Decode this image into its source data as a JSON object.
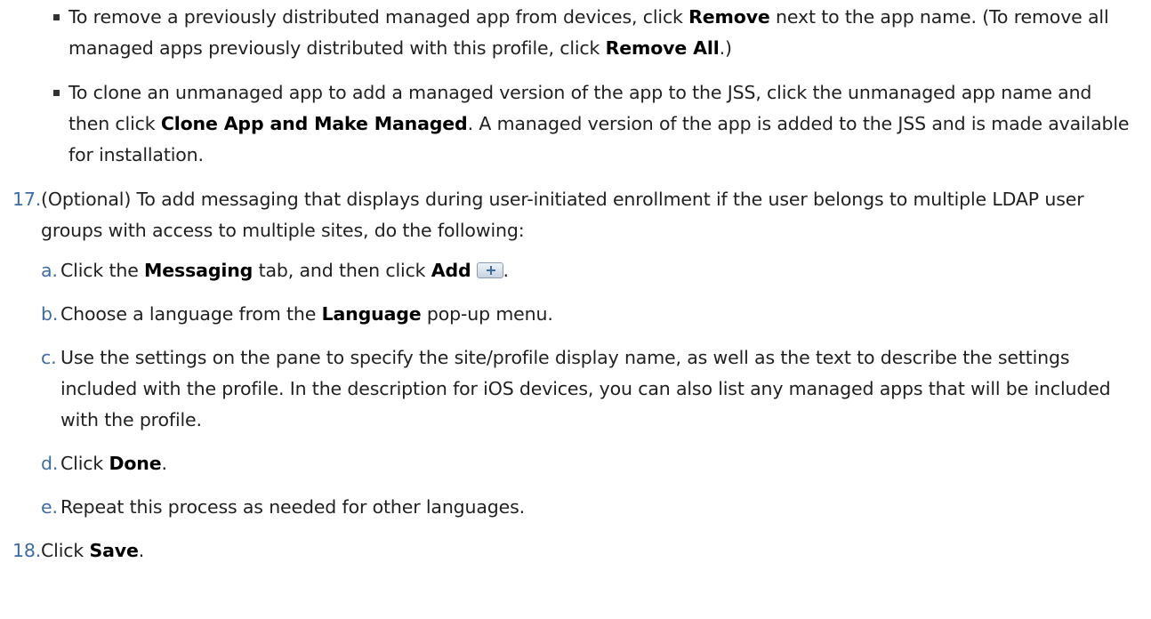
{
  "bullets": [
    {
      "t1": "To remove a previously distributed managed app from devices, click ",
      "b1": "Remove",
      "t2": " next to the app name. (To remove all managed apps previously distributed with this profile, click ",
      "b2": "Remove All",
      "t3": ".)"
    },
    {
      "t1": "To clone an unmanaged app to add a managed version of the app to the JSS, click the unmanaged app name and then click ",
      "b1": "Clone App and Make Managed",
      "t2": ". A managed version of the app is added to the JSS and is made available for installation."
    }
  ],
  "step17": {
    "num": "17.",
    "text": "(Optional) To add messaging that displays during user-initiated enrollment if the user belongs to multiple LDAP user groups with access to multiple sites, do the following:",
    "substeps": {
      "a": {
        "letter": "a.",
        "t1": "Click the ",
        "b1": "Messaging",
        "t2": " tab, and then click ",
        "b2": "Add",
        "t3": "."
      },
      "b": {
        "letter": "b.",
        "t1": "Choose a language from the ",
        "b1": "Language",
        "t2": " pop-up menu."
      },
      "c": {
        "letter": "c.",
        "t1": "Use the settings on the pane to specify the site/profile display name, as well as the text to describe the settings included with the profile. In the description for iOS devices, you can also list any managed apps that will be included with the profile."
      },
      "d": {
        "letter": "d.",
        "t1": "Click ",
        "b1": "Done",
        "t2": "."
      },
      "e": {
        "letter": "e.",
        "t1": "Repeat this process as needed for other languages."
      }
    }
  },
  "step18": {
    "num": "18.",
    "t1": "Click ",
    "b1": "Save",
    "t2": "."
  },
  "icons": {
    "add_button_icon": "plus-icon"
  },
  "colors": {
    "list_number": "#3b6ca8",
    "text": "#1f1f1f"
  }
}
